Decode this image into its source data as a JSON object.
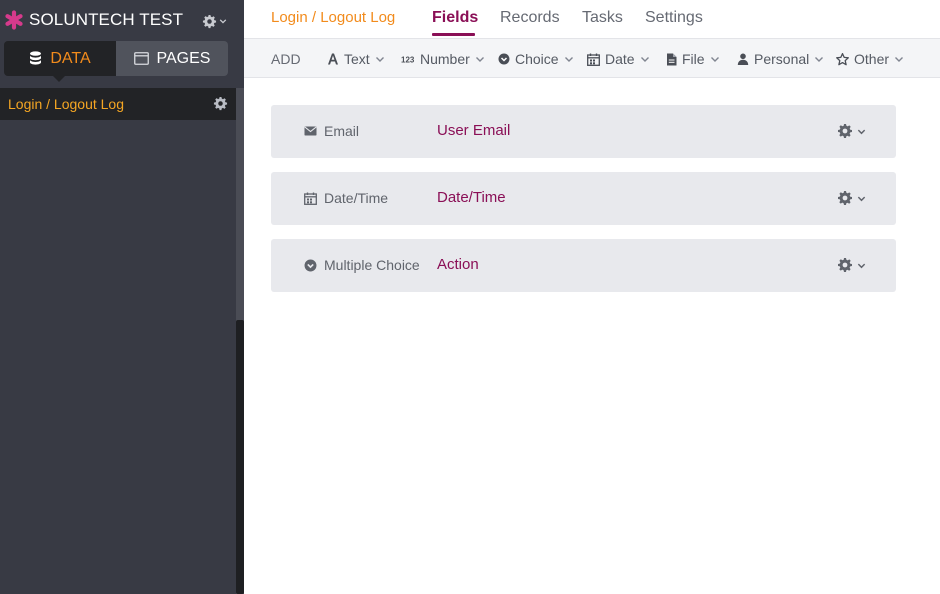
{
  "app": {
    "name": "SOLUNTECH TEST"
  },
  "modes": {
    "data_label": "DATA",
    "pages_label": "PAGES"
  },
  "sidebar": {
    "objects": [
      {
        "label": "Login / Logout Log"
      }
    ]
  },
  "breadcrumb": "Login / Logout Log",
  "nav": {
    "tabs": [
      {
        "label": "Fields",
        "active": true
      },
      {
        "label": "Records"
      },
      {
        "label": "Tasks"
      },
      {
        "label": "Settings"
      }
    ]
  },
  "toolbar": {
    "add_label": "ADD",
    "items": [
      {
        "label": "Text",
        "icon": "text-font-icon"
      },
      {
        "label": "Number",
        "icon": "number-123-icon"
      },
      {
        "label": "Choice",
        "icon": "choice-circle-icon"
      },
      {
        "label": "Date",
        "icon": "calendar-icon"
      },
      {
        "label": "File",
        "icon": "file-icon"
      },
      {
        "label": "Personal",
        "icon": "person-icon"
      },
      {
        "label": "Other",
        "icon": "star-icon"
      }
    ]
  },
  "fields": [
    {
      "type": "Email",
      "name": "User Email",
      "icon": "envelope-icon"
    },
    {
      "type": "Date/Time",
      "name": "Date/Time",
      "icon": "calendar-icon"
    },
    {
      "type": "Multiple Choice",
      "name": "Action",
      "icon": "choice-circle-icon"
    }
  ],
  "colors": {
    "accent_orange": "#f28b1c",
    "accent_purple": "#8a0f56",
    "sidebar_bg": "#383a44"
  }
}
